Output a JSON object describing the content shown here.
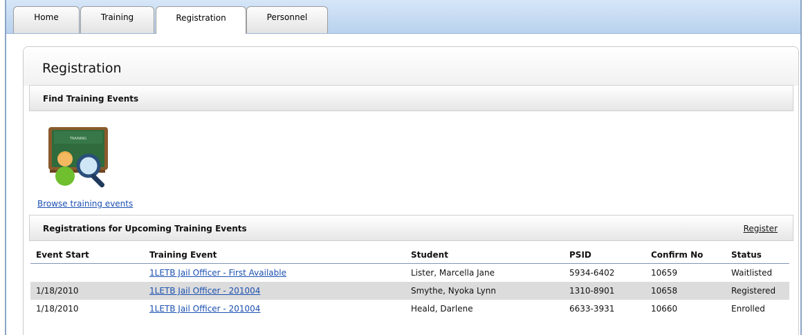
{
  "tabs": [
    {
      "label": "Home"
    },
    {
      "label": "Training"
    },
    {
      "label": "Registration",
      "active": true
    },
    {
      "label": "Personnel"
    }
  ],
  "page": {
    "title": "Registration"
  },
  "find_section": {
    "title": "Find Training Events",
    "icon": "training-board-search-icon",
    "icon_text": "TRAINING",
    "browse_link": "Browse training events"
  },
  "registrations_section": {
    "title": "Registrations for Upcoming Training Events",
    "register_link": "Register",
    "columns": [
      "Event Start",
      "Training Event",
      "Student",
      "PSID",
      "Confirm No",
      "Status"
    ],
    "rows": [
      {
        "event_start": "",
        "training_event": "1LETB Jail Officer - First Available",
        "student": "Lister, Marcella Jane",
        "psid": "5934-6402",
        "confirm_no": "10659",
        "status": "Waitlisted"
      },
      {
        "event_start": "1/18/2010",
        "training_event": "1LETB Jail Officer - 201004",
        "student": "Smythe, Nyoka Lynn",
        "psid": "1310-8901",
        "confirm_no": "10658",
        "status": "Registered"
      },
      {
        "event_start": "1/18/2010",
        "training_event": "1LETB Jail Officer - 201004",
        "student": "Heald, Darlene",
        "psid": "6633-3931",
        "confirm_no": "10660",
        "status": "Enrolled"
      }
    ]
  },
  "colors": {
    "tabbar": "#c7dcf3",
    "link": "#1a4fb0",
    "alt_row": "#dcdcdc"
  }
}
